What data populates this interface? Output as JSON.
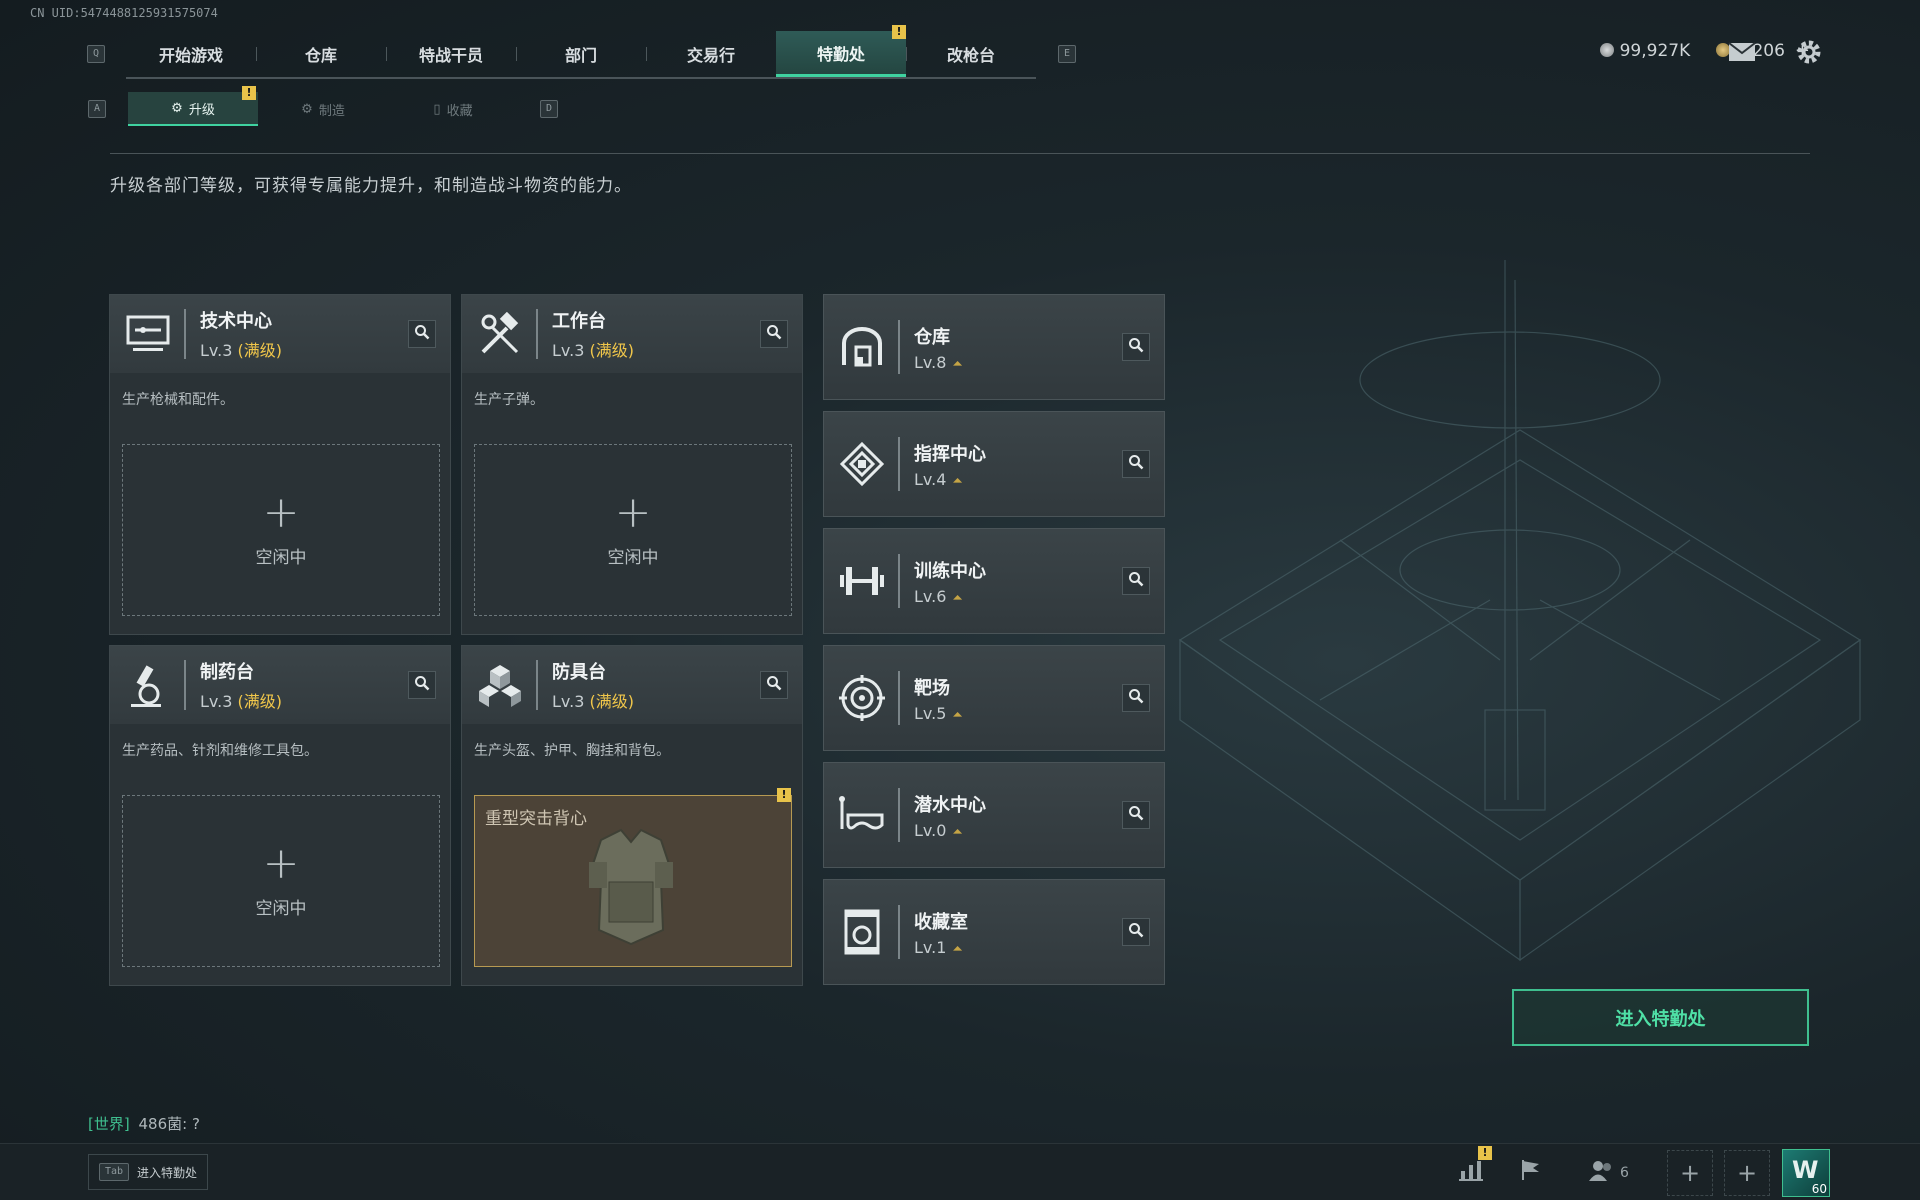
{
  "uid": "CN UID:5474488125931575074",
  "main_tabs": {
    "prev_key": "Q",
    "next_key": "E",
    "items": [
      {
        "label": "开始游戏"
      },
      {
        "label": "仓库"
      },
      {
        "label": "特战干员"
      },
      {
        "label": "部门"
      },
      {
        "label": "交易行"
      },
      {
        "label": "特勤处",
        "active": true,
        "warning": "!"
      },
      {
        "label": "改枪台"
      }
    ]
  },
  "currency": {
    "primary": "99,927K",
    "secondary": "1,206",
    "add": "+"
  },
  "sub_tabs": {
    "prev_key": "A",
    "next_key": "D",
    "items": [
      {
        "label": "升级",
        "active": true,
        "warning": "!"
      },
      {
        "label": "制造"
      },
      {
        "label": "收藏"
      }
    ]
  },
  "description": "升级各部门等级，可获得专属能力提升，和制造战斗物资的能力。",
  "level_max_label": "(满级)",
  "idle_label": "空闲中",
  "departments": [
    {
      "name": "技术中心",
      "level": "Lv.3",
      "desc": "生产枪械和配件。",
      "icon": "tech-center-icon"
    },
    {
      "name": "工作台",
      "level": "Lv.3",
      "desc": "生产子弹。",
      "icon": "workbench-icon"
    },
    {
      "name": "制药台",
      "level": "Lv.3",
      "desc": "生产药品、针剂和维修工具包。",
      "icon": "pharmacy-icon"
    },
    {
      "name": "防具台",
      "level": "Lv.3",
      "desc": "生产头盔、护甲、胸挂和背包。",
      "icon": "armor-bench-icon",
      "production": {
        "item": "重型突击背心",
        "warning": "!"
      }
    }
  ],
  "facilities": [
    {
      "name": "仓库",
      "level": "Lv.8",
      "icon": "warehouse-icon"
    },
    {
      "name": "指挥中心",
      "level": "Lv.4",
      "icon": "command-center-icon"
    },
    {
      "name": "训练中心",
      "level": "Lv.6",
      "icon": "training-center-icon"
    },
    {
      "name": "靶场",
      "level": "Lv.5",
      "icon": "shooting-range-icon"
    },
    {
      "name": "潜水中心",
      "level": "Lv.0",
      "icon": "diving-center-icon"
    },
    {
      "name": "收藏室",
      "level": "Lv.1",
      "icon": "collection-room-icon"
    }
  ],
  "enter_button": "进入特勤处",
  "chat": {
    "channel": "[世界]",
    "text": "486菌: ?"
  },
  "bottom": {
    "tab_key": "Tab",
    "tab_label": "进入特勤处",
    "friends_count": "6",
    "avatar_level": "60",
    "stats_warning": "!"
  },
  "colors": {
    "accent": "#3fd2a0",
    "warning": "#e8c34a",
    "maxed": "#f0c64a"
  }
}
